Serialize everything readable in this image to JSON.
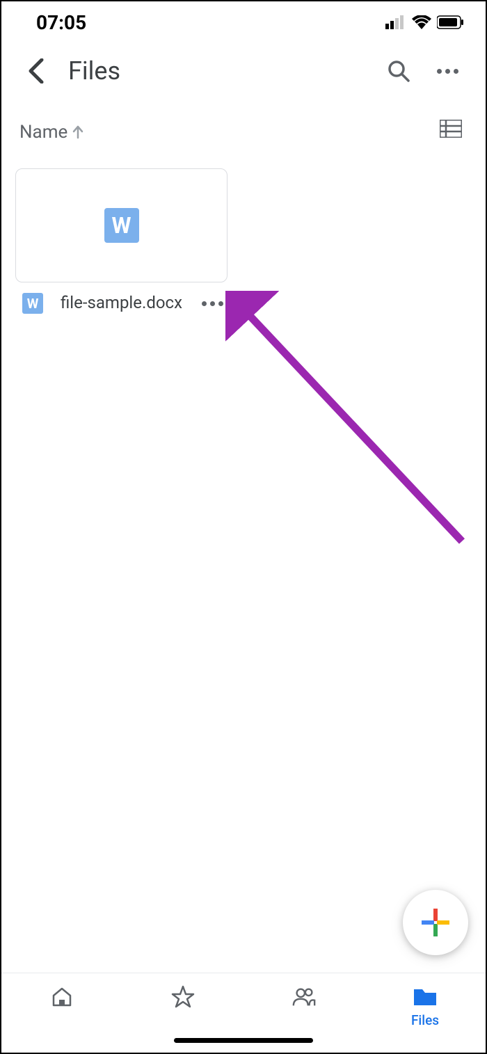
{
  "statusBar": {
    "time": "07:05"
  },
  "header": {
    "title": "Files"
  },
  "sort": {
    "label": "Name"
  },
  "file": {
    "name": "file-sample.docx",
    "typeGlyph": "W"
  },
  "bottomNav": {
    "activeLabel": "Files"
  }
}
